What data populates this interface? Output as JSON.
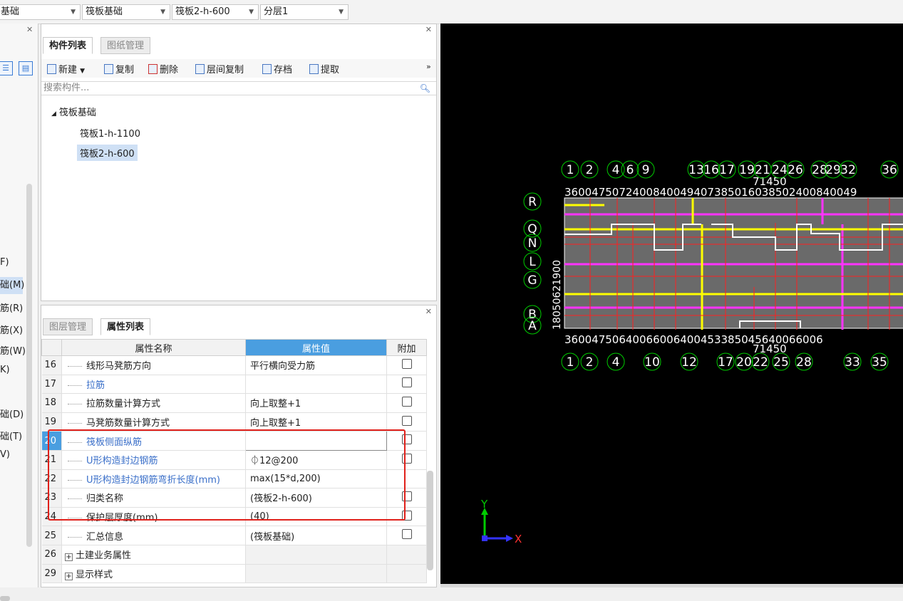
{
  "topbar": {
    "dropdowns": [
      "基础",
      "筏板基础",
      "筏板2-h-600",
      "分层1"
    ]
  },
  "left_panel": {
    "items": [
      {
        "label": "F)",
        "selected": false
      },
      {
        "label": "础(M)",
        "selected": true
      },
      {
        "label": "筋(R)",
        "selected": false
      },
      {
        "label": "筋(X)",
        "selected": false
      },
      {
        "label": "筋(W)",
        "selected": false
      },
      {
        "label": "K)",
        "selected": false
      },
      {
        "label": "础(D)",
        "selected": false
      },
      {
        "label": "础(T)",
        "selected": false
      },
      {
        "label": "V)",
        "selected": false
      }
    ]
  },
  "component_panel": {
    "tabs": [
      "构件列表",
      "图纸管理"
    ],
    "toolbar": [
      "新建",
      "复制",
      "删除",
      "层间复制",
      "存档",
      "提取"
    ],
    "more": "»",
    "search_placeholder": "搜索构件...",
    "tree": {
      "root": "筏板基础",
      "root_toggle": "◢",
      "children": [
        "筏板1-h-1100",
        "筏板2-h-600"
      ],
      "selected": "筏板2-h-600"
    }
  },
  "property_panel": {
    "tabs": [
      "图层管理",
      "属性列表"
    ],
    "headers": {
      "name": "属性名称",
      "value": "属性值",
      "extra": "附加"
    },
    "rows": [
      {
        "num": "16",
        "name": "线形马凳筋方向",
        "value": "平行横向受力筋",
        "blue": false,
        "checkbox": true
      },
      {
        "num": "17",
        "name": "拉筋",
        "value": "",
        "blue": true,
        "checkbox": true
      },
      {
        "num": "18",
        "name": "拉筋数量计算方式",
        "value": "向上取整+1",
        "blue": false,
        "checkbox": true
      },
      {
        "num": "19",
        "name": "马凳筋数量计算方式",
        "value": "向上取整+1",
        "blue": false,
        "checkbox": true
      },
      {
        "num": "20",
        "name": "筏板侧面纵筋",
        "value": "",
        "blue": true,
        "checkbox": true
      },
      {
        "num": "21",
        "name": "U形构造封边钢筋",
        "value": "⏀12@200",
        "blue": true,
        "checkbox": true
      },
      {
        "num": "22",
        "name": "U形构造封边钢筋弯折长度(mm)",
        "value": "max(15*d,200)",
        "blue": true,
        "checkbox": false
      },
      {
        "num": "23",
        "name": "归类名称",
        "value": "(筏板2-h-600)",
        "blue": false,
        "checkbox": true
      },
      {
        "num": "24",
        "name": "保护层厚度(mm)",
        "value": "(40)",
        "blue": false,
        "checkbox": true
      },
      {
        "num": "25",
        "name": "汇总信息",
        "value": "(筏板基础)",
        "blue": false,
        "checkbox": true
      },
      {
        "num": "26",
        "name": "土建业务属性",
        "value": "",
        "blue": false,
        "checkbox": false,
        "expand": true
      },
      {
        "num": "29",
        "name": "显示样式",
        "value": "",
        "blue": false,
        "checkbox": false,
        "expand": true
      }
    ]
  },
  "cad": {
    "top_axis_labels": [
      "1",
      "2",
      "4",
      "6",
      "9",
      "13",
      "16",
      "17",
      "19",
      "21",
      "24",
      "26",
      "28",
      "29",
      "32",
      "36"
    ],
    "top_dims": "3600475072400840049407385016038502400840049",
    "top_total": "71450",
    "bottom_axis_labels": [
      "1",
      "2",
      "4",
      "10",
      "12",
      "17",
      "20",
      "22",
      "25",
      "28",
      "33",
      "35"
    ],
    "bottom_dims": "36004750640066006400453385045640066006",
    "bottom_total": "71450",
    "row_labels": [
      "R",
      "Q",
      "N",
      "L",
      "G",
      "B",
      "A"
    ],
    "left_dims": "18050621900",
    "ucs": {
      "y": "Y",
      "x": "X"
    }
  }
}
